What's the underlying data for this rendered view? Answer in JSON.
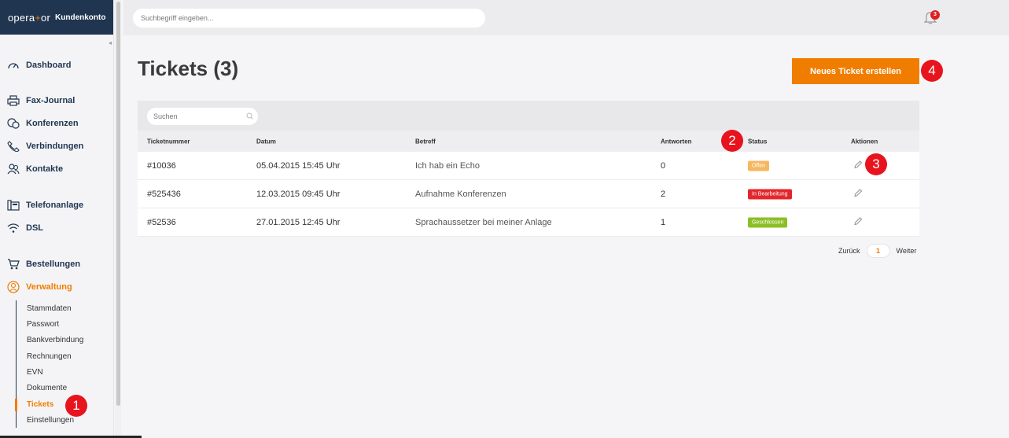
{
  "brand": {
    "logo_pre": "opera",
    "logo_plus": "+",
    "logo_post": "or",
    "subtitle": "Kundenkonto"
  },
  "sidebar": {
    "items": [
      {
        "label": "Dashboard",
        "icon": "gauge-icon"
      },
      {
        "label": "Fax-Journal",
        "icon": "printer-icon"
      },
      {
        "label": "Konferenzen",
        "icon": "chat-icon"
      },
      {
        "label": "Verbindungen",
        "icon": "phone-icon"
      },
      {
        "label": "Kontakte",
        "icon": "users-icon"
      },
      {
        "label": "Telefonanlage",
        "icon": "phone-system-icon"
      },
      {
        "label": "DSL",
        "icon": "wifi-icon"
      },
      {
        "label": "Bestellungen",
        "icon": "cart-icon"
      },
      {
        "label": "Verwaltung",
        "icon": "user-circle-icon"
      }
    ],
    "sub_items": [
      "Stammdaten",
      "Passwort",
      "Bankverbindung",
      "Rechnungen",
      "EVN",
      "Dokumente",
      "Tickets",
      "Einstellungen"
    ]
  },
  "topbar": {
    "search_placeholder": "Suchbegriff eingeben...",
    "notification_count": "3"
  },
  "main": {
    "title": "Tickets (3)",
    "new_button": "Neues Ticket erstellen",
    "filter_placeholder": "Suchen",
    "columns": [
      "Ticketnummer",
      "Datum",
      "Betreff",
      "Antworten",
      "Status",
      "Aktionen"
    ],
    "rows": [
      {
        "id": "#10036",
        "date": "05.04.2015 15:45 Uhr",
        "subject": "Ich hab ein Echo",
        "replies": "0",
        "status": "Offen",
        "status_color": "#f5b860"
      },
      {
        "id": "#525436",
        "date": "12.03.2015 09:45 Uhr",
        "subject": "Aufnahme Konferenzen",
        "replies": "2",
        "status": "In Bearbeitung",
        "status_color": "#e3262c"
      },
      {
        "id": "#52536",
        "date": "27.01.2015 12:45 Uhr",
        "subject": "Sprachaussetzer bei meiner Anlage",
        "replies": "1",
        "status": "Geschlossen",
        "status_color": "#8cbf26"
      }
    ],
    "pagination": {
      "prev": "Zurück",
      "page": "1",
      "next": "Weiter"
    }
  },
  "markers": [
    "1",
    "2",
    "3",
    "4"
  ],
  "colors": {
    "accent": "#f07d00",
    "navy": "#1f3550",
    "marker": "#e8141d"
  }
}
